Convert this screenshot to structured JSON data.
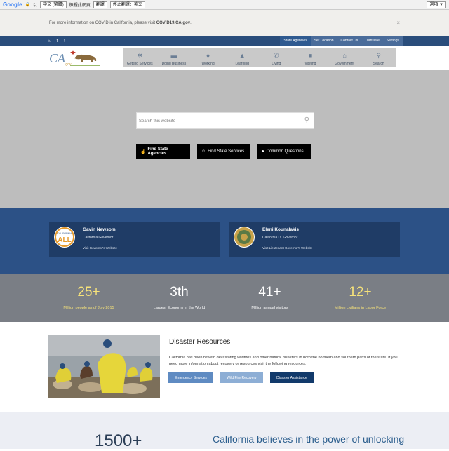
{
  "translate_bar": {
    "logo": "Google",
    "language_prefix": "以",
    "language": "中文 (繁體)",
    "view_label": "檢視此網頁",
    "translate_button": "翻譯",
    "stop_button": "停止翻譯：英文",
    "options_button": "選項 ▼"
  },
  "alert": {
    "text": "For more information on COVID in California, please visit ",
    "link": "COVID19.CA.gov",
    "suffix": "."
  },
  "utility": {
    "links": [
      "State Agencies",
      "Set Location",
      "Contact Us",
      "Translate",
      "Settings"
    ]
  },
  "nav": {
    "items": [
      {
        "label": "Getting Services",
        "icon": "services-icon"
      },
      {
        "label": "Doing Business",
        "icon": "briefcase-icon"
      },
      {
        "label": "Working",
        "icon": "lightbulb-icon"
      },
      {
        "label": "Learning",
        "icon": "graduation-cap-icon"
      },
      {
        "label": "Living",
        "icon": "phone-icon"
      },
      {
        "label": "Visiting",
        "icon": "camera-icon"
      },
      {
        "label": "Government",
        "icon": "capitol-icon"
      },
      {
        "label": "Search",
        "icon": "search-icon"
      }
    ]
  },
  "hero": {
    "search_placeholder": "Search this website",
    "buttons": [
      "Find State Agencies",
      "Find State Services",
      "Common Questions"
    ]
  },
  "leaders": [
    {
      "name": "Gavin Newsom",
      "role": "California Governor",
      "link": "Visit Governor's Website"
    },
    {
      "name": "Eleni Kounalakis",
      "role": "California Lt. Governor",
      "link": "Visit Lieutenant Governor's Website"
    }
  ],
  "leader_logo": {
    "top": "CALIFORNIA",
    "main": "ALL"
  },
  "stats": [
    {
      "value": "25+",
      "label": "Million people as of July 2015",
      "color": "#f6e27a"
    },
    {
      "value": "3th",
      "label": "Largest Economy in the World",
      "color": "#ffffff"
    },
    {
      "value": "41+",
      "label": "Million annual visitors",
      "color": "#ffffff"
    },
    {
      "value": "12+",
      "label": "Million civilians in Labor Force",
      "color": "#f6e27a"
    }
  ],
  "disaster": {
    "title": "Disaster Resources",
    "text": "California has been hit with devastating wildfires and other natural disasters in both the northern and southern parts of the state. If you need more information about recovery or resources visit the following resources:",
    "buttons": [
      "Emergency Services",
      "Wild Fire Recovery",
      "Disaster Assistance"
    ]
  },
  "bottom": {
    "number": "1500+",
    "tagline": "California believes in the power of unlocking"
  }
}
